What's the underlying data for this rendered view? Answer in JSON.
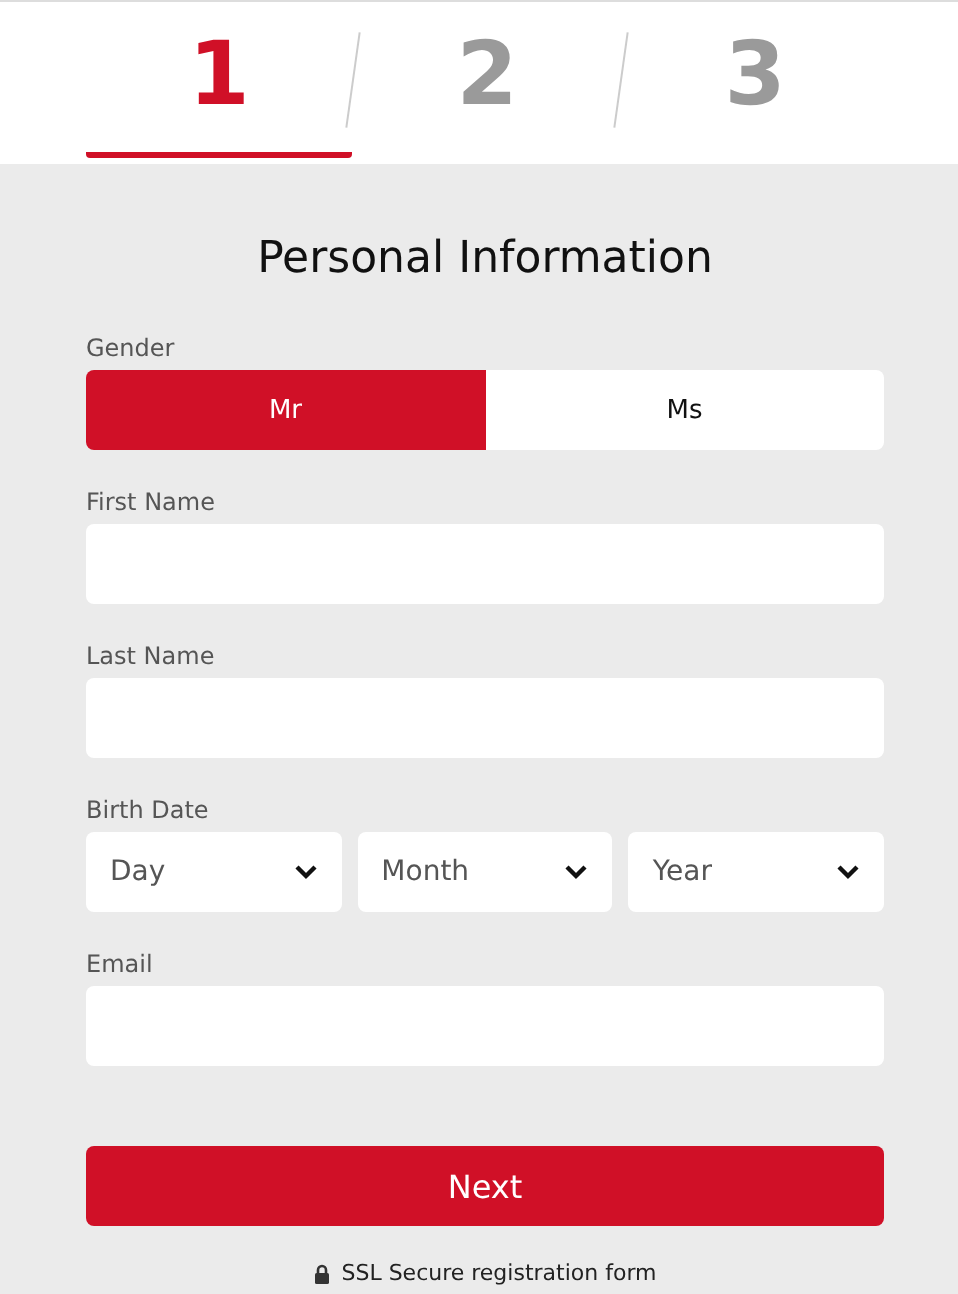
{
  "steps": [
    {
      "label": "1",
      "selected": true
    },
    {
      "label": "2",
      "selected": false
    },
    {
      "label": "3",
      "selected": false
    }
  ],
  "title": "Personal Information",
  "fields": [
    {
      "kind": "toggle",
      "label": "Gender",
      "options": [
        {
          "label": "Mr",
          "selected": true
        },
        {
          "label": "Ms",
          "selected": false
        }
      ]
    },
    {
      "kind": "text",
      "label": "First Name"
    },
    {
      "kind": "text",
      "label": "Last Name"
    },
    {
      "kind": "selects",
      "label": "Birth Date",
      "selects": [
        {
          "value": "Day"
        },
        {
          "value": "Month"
        },
        {
          "value": "Year"
        }
      ]
    },
    {
      "kind": "text",
      "label": "Email"
    }
  ],
  "submit": "Next",
  "secure_note": "SSL Secure registration form"
}
